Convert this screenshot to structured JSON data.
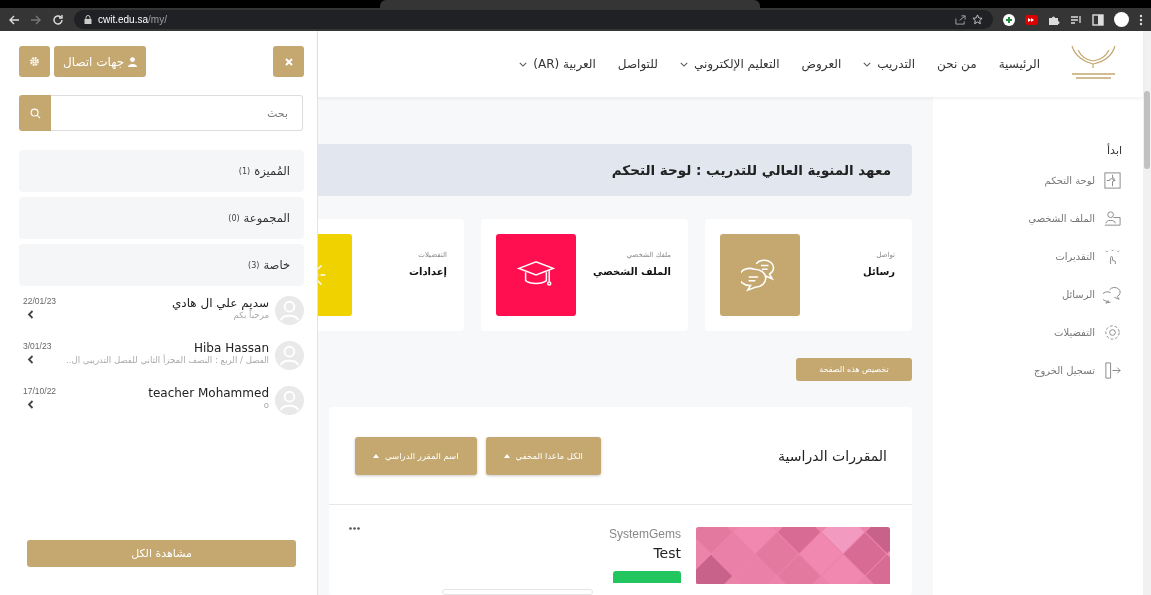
{
  "browser": {
    "url_host": "cwit.edu.sa",
    "url_path": "/my/"
  },
  "drawer": {
    "contacts_button": "جهات اتصال",
    "search": {
      "placeholder": "بحث"
    },
    "groups": [
      {
        "label": "المُميزة",
        "count": "(1)"
      },
      {
        "label": "المجموعة",
        "count": "(0)"
      },
      {
        "label": "خاصة",
        "count": "(3)"
      }
    ],
    "contacts": [
      {
        "name": "سديم علي ال هادي",
        "message": "مرحباً بكم",
        "date": "22/01/23"
      },
      {
        "name": "Hiba Hassan",
        "message": "الفصل / الربع : النصف المجزأ الثاني للفصل التدريبي ال..",
        "date": "3/01/23"
      },
      {
        "name": "teacher Mohammed",
        "message": "o",
        "date": "17/10/22"
      }
    ],
    "view_all": "مشاهدة الكل"
  },
  "nav": {
    "items": [
      {
        "label": "الرئيسية",
        "has_menu": false
      },
      {
        "label": "من نحن",
        "has_menu": false
      },
      {
        "label": "التدريب",
        "has_menu": true
      },
      {
        "label": "العروض",
        "has_menu": false
      },
      {
        "label": "التعليم الإلكتروني",
        "has_menu": true
      },
      {
        "label": "للتواصل",
        "has_menu": false
      },
      {
        "label": "العربية (AR)",
        "has_menu": true
      }
    ]
  },
  "page_title": "معهد المنوية العالي للتدريب : لوحة التحكم",
  "cards": [
    {
      "caption": "تواصل",
      "title": "رسائل",
      "color": "#c4a870"
    },
    {
      "caption": "ملفك الشخصي",
      "title": "الملف الشخصي",
      "color": "#ff0f50"
    },
    {
      "caption": "التفضيلات",
      "title": "إعدادات",
      "color": "#f0d200"
    }
  ],
  "customize_button": "تخصيص هذه الصفحة",
  "courses": {
    "title": "المقررات الدراسية",
    "filters": [
      "الكل ماعدا المخفي",
      "اسم المقرر الدراسي"
    ],
    "items": [
      {
        "category": "SystemGems",
        "name": "Test"
      }
    ]
  },
  "sidebar": {
    "heading": "ابدأ",
    "items": [
      "لوحة التحكم",
      "الملف الشخصي",
      "التقديرات",
      "الرسائل",
      "التفضيلات",
      "تسجيل الخروج"
    ]
  }
}
